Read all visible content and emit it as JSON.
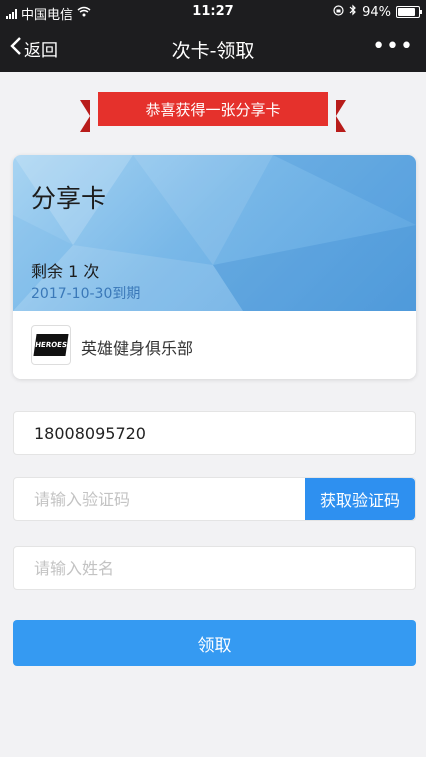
{
  "status_bar": {
    "carrier": "中国电信",
    "time": "11:27",
    "battery": "94%",
    "battery_level": 0.94
  },
  "nav": {
    "back_label": "返回",
    "title": "次卡-领取",
    "more_label": "•••"
  },
  "banner": {
    "text": "恭喜获得一张分享卡"
  },
  "card": {
    "name": "分享卡",
    "remaining": "剩余 1 次",
    "expiry": "2017-10-30到期",
    "club_name": "英雄健身俱乐部",
    "logo_text": "HEROES"
  },
  "form": {
    "phone_value": "18008095720",
    "code_placeholder": "请输入验证码",
    "get_code_label": "获取验证码",
    "name_placeholder": "请输入姓名",
    "submit_label": "领取"
  },
  "colors": {
    "accent": "#359af2",
    "ribbon": "#e5312c",
    "nav_bg": "#1d1d1f"
  }
}
